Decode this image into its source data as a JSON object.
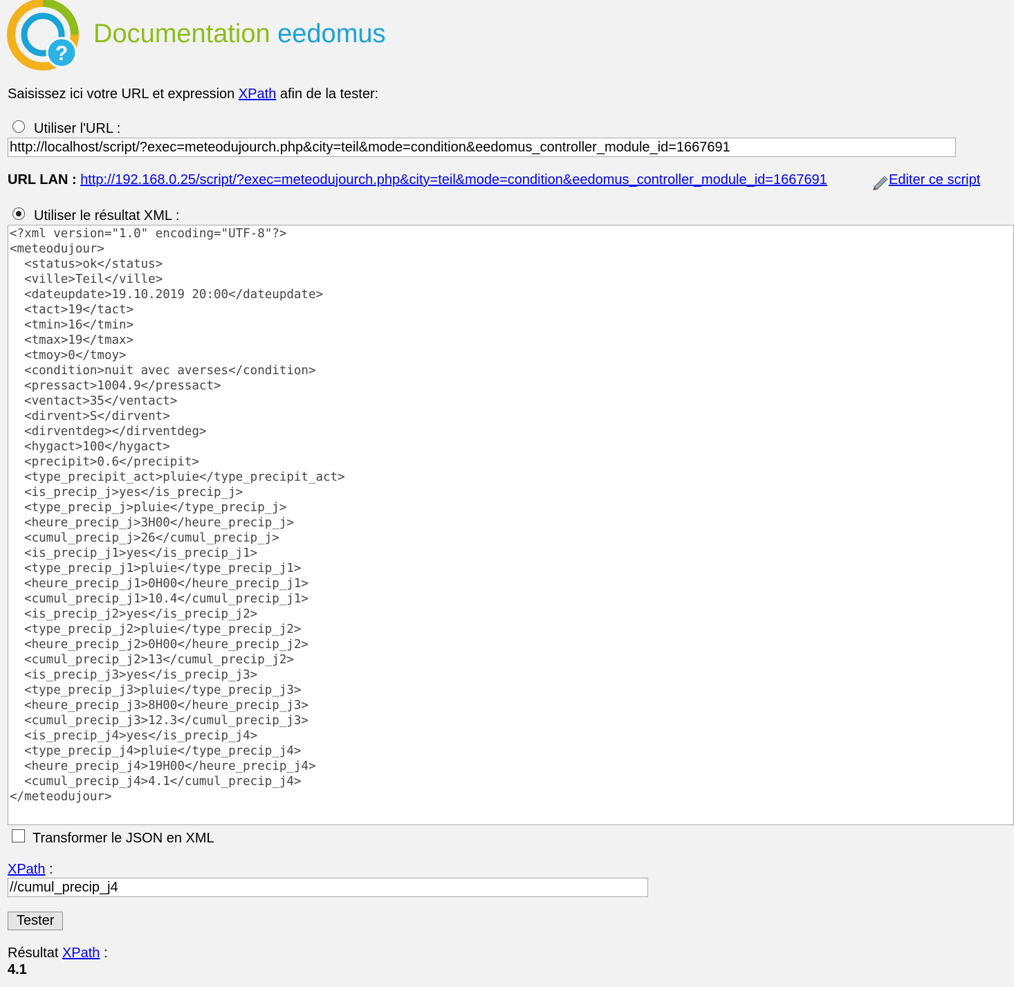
{
  "header": {
    "title_prefix": "Documentation ",
    "title_brand": "eedomus",
    "logo_glyph": "?"
  },
  "intro": {
    "text_before": "Saisissez ici votre URL et expression ",
    "xpath_link": "XPath",
    "text_after": " afin de la tester:"
  },
  "url_option": {
    "label": "Utiliser l'URL :",
    "selected": false,
    "value": "http://localhost/script/?exec=meteodujourch.php&city=teil&mode=condition&eedomus_controller_module_id=1667691"
  },
  "url_lan": {
    "label": "URL LAN :",
    "link": "http://192.168.0.25/script/?exec=meteodujourch.php&city=teil&mode=condition&eedomus_controller_module_id=1667691",
    "edit_icon": "pencil-icon",
    "edit_link": " Editer ce script"
  },
  "xml_option": {
    "label": "Utiliser le résultat XML :",
    "selected": true,
    "value": "<?xml version=\"1.0\" encoding=\"UTF-8\"?>\n<meteodujour>\n  <status>ok</status>\n  <ville>Teil</ville>\n  <dateupdate>19.10.2019 20:00</dateupdate>\n  <tact>19</tact>\n  <tmin>16</tmin>\n  <tmax>19</tmax>\n  <tmoy>0</tmoy>\n  <condition>nuit avec averses</condition>\n  <pressact>1004.9</pressact>\n  <ventact>35</ventact>\n  <dirvent>S</dirvent>\n  <dirventdeg></dirventdeg>\n  <hygact>100</hygact>\n  <precipit>0.6</precipit>\n  <type_precipit_act>pluie</type_precipit_act>\n  <is_precip_j>yes</is_precip_j>\n  <type_precip_j>pluie</type_precip_j>\n  <heure_precip_j>3H00</heure_precip_j>\n  <cumul_precip_j>26</cumul_precip_j>\n  <is_precip_j1>yes</is_precip_j1>\n  <type_precip_j1>pluie</type_precip_j1>\n  <heure_precip_j1>0H00</heure_precip_j1>\n  <cumul_precip_j1>10.4</cumul_precip_j1>\n  <is_precip_j2>yes</is_precip_j2>\n  <type_precip_j2>pluie</type_precip_j2>\n  <heure_precip_j2>0H00</heure_precip_j2>\n  <cumul_precip_j2>13</cumul_precip_j2>\n  <is_precip_j3>yes</is_precip_j3>\n  <type_precip_j3>pluie</type_precip_j3>\n  <heure_precip_j3>8H00</heure_precip_j3>\n  <cumul_precip_j3>12.3</cumul_precip_j3>\n  <is_precip_j4>yes</is_precip_j4>\n  <type_precip_j4>pluie</type_precip_j4>\n  <heure_precip_j4>19H00</heure_precip_j4>\n  <cumul_precip_j4>4.1</cumul_precip_j4>\n</meteodujour>"
  },
  "json_option": {
    "label": "Transformer le JSON en XML",
    "checked": false
  },
  "xpath": {
    "link": "XPath",
    "suffix": " :",
    "value": "//cumul_precip_j4"
  },
  "test_button": {
    "label": "Tester"
  },
  "result": {
    "label_prefix": "Résultat ",
    "link": "XPath",
    "suffix": " :",
    "value": "4.1"
  },
  "colors": {
    "title_green": "#8fbc1c",
    "title_blue": "#1aa3d6",
    "link": "#0000ee",
    "background": "#f2f2f2"
  }
}
